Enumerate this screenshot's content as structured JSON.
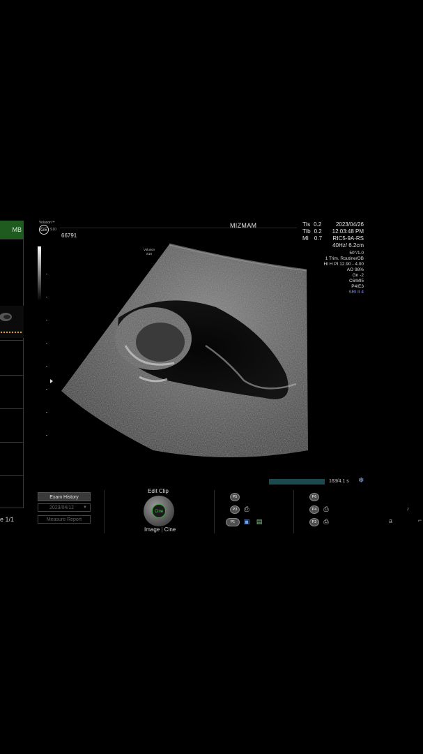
{
  "left_panel": {
    "tab_label": "MB",
    "page_indicator": "e 1/1"
  },
  "header": {
    "brand": "Voluson™",
    "model": "S10",
    "logo_text": "GE",
    "patient_id": "66791",
    "patient_name": "MIZMAM",
    "probe_label_line1": "Voluson",
    "probe_label_line2": "S10"
  },
  "indices": {
    "tis_label": "TIs",
    "tis_value": "0.2",
    "tib_label": "TIb",
    "tib_value": "0.2",
    "mi_label": "MI",
    "mi_value": "0.7"
  },
  "datetime": {
    "date": "2023/04/26",
    "time": "12:03:48 PM",
    "probe": "RIC5-9A-RS",
    "freq_depth": "40Hz/ 6.2cm"
  },
  "params": {
    "angle": "50°/1.0",
    "preset": "1 Trim. Routine/OB",
    "harmonic": "HI H PI 12.90 - 4.00",
    "ao": "AO 98%",
    "gain": "Gn  -2",
    "map": "C6/MI5",
    "persistence": "P4/E3",
    "sri": "SRI II 4"
  },
  "cine": {
    "frames": "163/4.1 s",
    "freeze_icon": "snowflake-icon"
  },
  "controls": {
    "exam_history": "Exam History",
    "exam_date": "2023/04/12",
    "measure_report": "Measure Report",
    "edit_clip": "Edit Clip",
    "knob_label": "Cine",
    "image_label": "Image",
    "separator": "|",
    "cine_label": "Cine"
  },
  "p_buttons_left": [
    "P5",
    "P3",
    "P1"
  ],
  "p_buttons_right": [
    "P6",
    "P4",
    "P2"
  ],
  "far_right": {
    "letter": "a"
  },
  "colors": {
    "tab_green": "#1f5a1f",
    "cine_bar": "#1d4a4f",
    "sri_blue": "#8a8cff"
  }
}
